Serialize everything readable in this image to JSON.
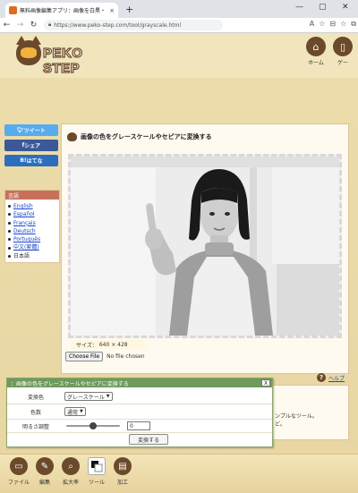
{
  "browser": {
    "tab_title": "無料画像編集アプリ：画像を白黒・",
    "tab_close": "×",
    "new_tab": "+",
    "url": "https://www.peko-step.com/tool/grayscale.html",
    "window_controls": [
      "—",
      "▢",
      "✕"
    ]
  },
  "site": {
    "logo_text": "PEKO STEP",
    "header_buttons": [
      {
        "label": "ホーム",
        "icon": "home-icon"
      },
      {
        "label": "ゲー",
        "icon": "game-icon"
      }
    ]
  },
  "share": [
    {
      "label": "ツイート",
      "icon": "bird-icon",
      "color": "#55acee"
    },
    {
      "label": "シェア",
      "icon": "facebook-icon",
      "color": "#3b5998"
    },
    {
      "label": "はてな",
      "icon": "hatena-icon",
      "color": "#2c6ebd"
    }
  ],
  "languages": {
    "heading": "言語",
    "items": [
      "English",
      "Español",
      "Français",
      "Deutsch",
      "Português",
      "中文(繁體)",
      "日本語"
    ]
  },
  "main": {
    "title": "画像の色をグレースケールやセピアに変換する",
    "size_prefix": "サイズ：",
    "size_value": "640 × 428",
    "choose_file": "Choose File",
    "no_file": "No file chosen"
  },
  "help": {
    "icon": "?",
    "label": "ヘルプ"
  },
  "description": {
    "line1": "ンプルなツール。",
    "line2": "ど。"
  },
  "dialog": {
    "title": "：画像の色をグレースケールやセピアに変換する",
    "close": "X",
    "color_label": "変換色",
    "color_value": "グレースケール",
    "tone_label": "色数",
    "tone_value": "通常",
    "brightness_label": "明るさ調整",
    "brightness_value": "0",
    "brightness_level": 0.5,
    "convert_button": "変換する"
  },
  "toolbar": [
    {
      "label": "ファイル",
      "icon": "folder-icon"
    },
    {
      "label": "編集",
      "icon": "pencil-icon"
    },
    {
      "label": "拡大率",
      "icon": "zoom-icon"
    },
    {
      "label": "ツール",
      "icon": "color-swatch-icon"
    },
    {
      "label": "加工",
      "icon": "document-icon"
    }
  ],
  "colors": {
    "brand_brown": "#6b4a2b",
    "dialog_green": "#6f9a5c"
  }
}
